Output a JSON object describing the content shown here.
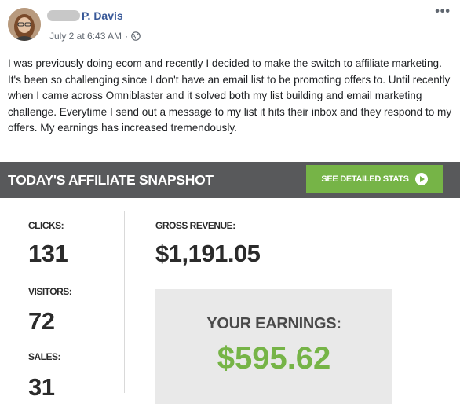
{
  "post": {
    "author_visible": "P. Davis",
    "timestamp": "July 2 at 6:43 AM",
    "separator": "·",
    "audience_icon": "globe-icon",
    "more_label": "•••",
    "body": "I was previously doing ecom and recently I decided to make the switch to affiliate marketing. It's been so challenging since I don't have an email list to be promoting offers to. Until recently when I came across Omniblaster and it solved both my list building and email marketing challenge. Everytime I send out a message to my list it hits their inbox and they respond to my offers. My earnings has increased tremendously."
  },
  "snapshot": {
    "title": "TODAY'S AFFILIATE SNAPSHOT",
    "button_label": "SEE DETAILED STATS",
    "clicks_label": "CLICKS:",
    "clicks_value": "131",
    "visitors_label": "VISITORS:",
    "visitors_value": "72",
    "sales_label": "SALES:",
    "sales_value": "31",
    "gross_label": "GROSS REVENUE:",
    "gross_value": "$1,191.05",
    "earnings_label": "YOUR EARNINGS:",
    "earnings_value": "$595.62"
  },
  "colors": {
    "name_link": "#385898",
    "bar": "#58595b",
    "accent_green": "#76b447",
    "earnings_box": "#e9e9e9"
  }
}
